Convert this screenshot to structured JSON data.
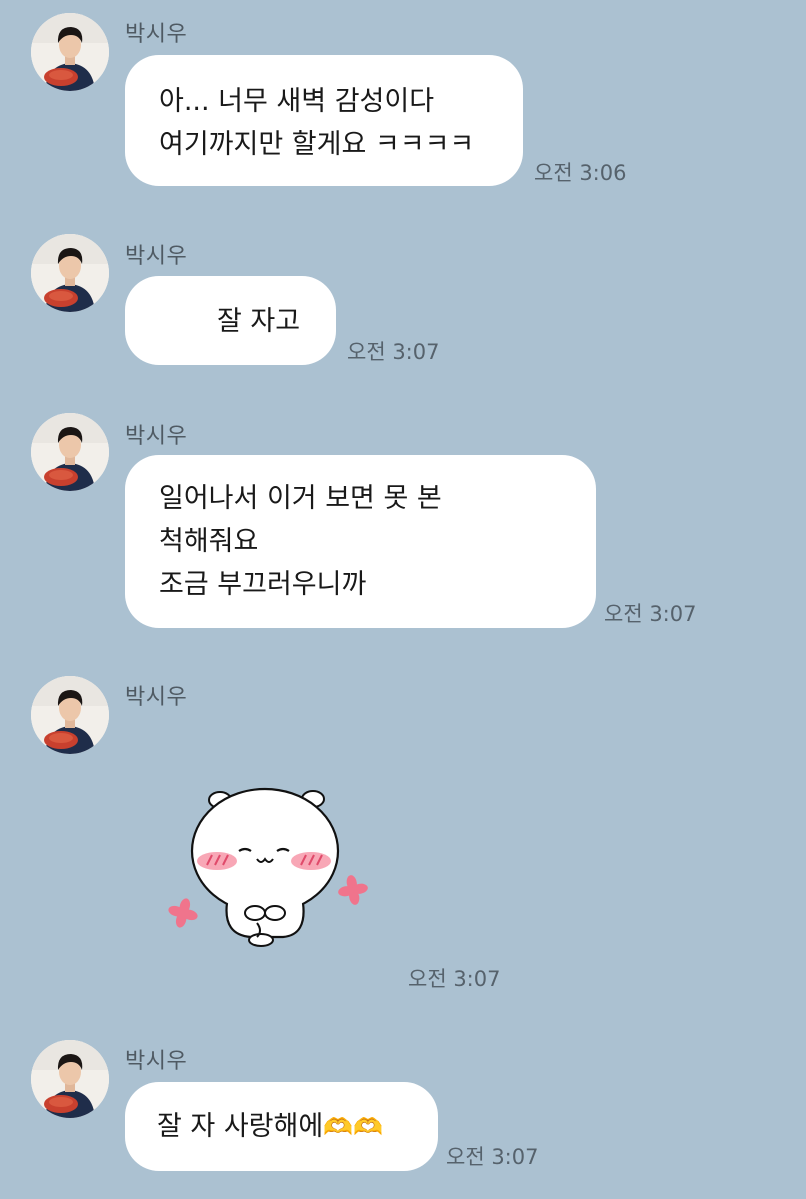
{
  "messages": [
    {
      "sender": "박시우",
      "lines": [
        "아... 너무 새벽 감성이다",
        "여기까지만 할게요 ㅋㅋㅋㅋ"
      ],
      "time": "오전 3:06"
    },
    {
      "sender": "박시우",
      "lines": [
        "잘 자고"
      ],
      "time": "오전 3:07"
    },
    {
      "sender": "박시우",
      "lines": [
        "일어나서 이거 보면 못 본",
        "척해줘요",
        "조금 부끄러우니까"
      ],
      "time": "오전 3:07"
    },
    {
      "sender": "박시우",
      "sticker": "blushing-white-hamster-sticker",
      "time": "오전 3:07"
    },
    {
      "sender": "박시우",
      "lines": [
        "잘 자 사랑해에"
      ],
      "emoji": "🫶🫶",
      "time": "오전 3:07"
    }
  ],
  "colors": {
    "chat_background": "#abc1d1",
    "bubble": "#ffffff",
    "sticker_blush": "#f58a9e"
  }
}
